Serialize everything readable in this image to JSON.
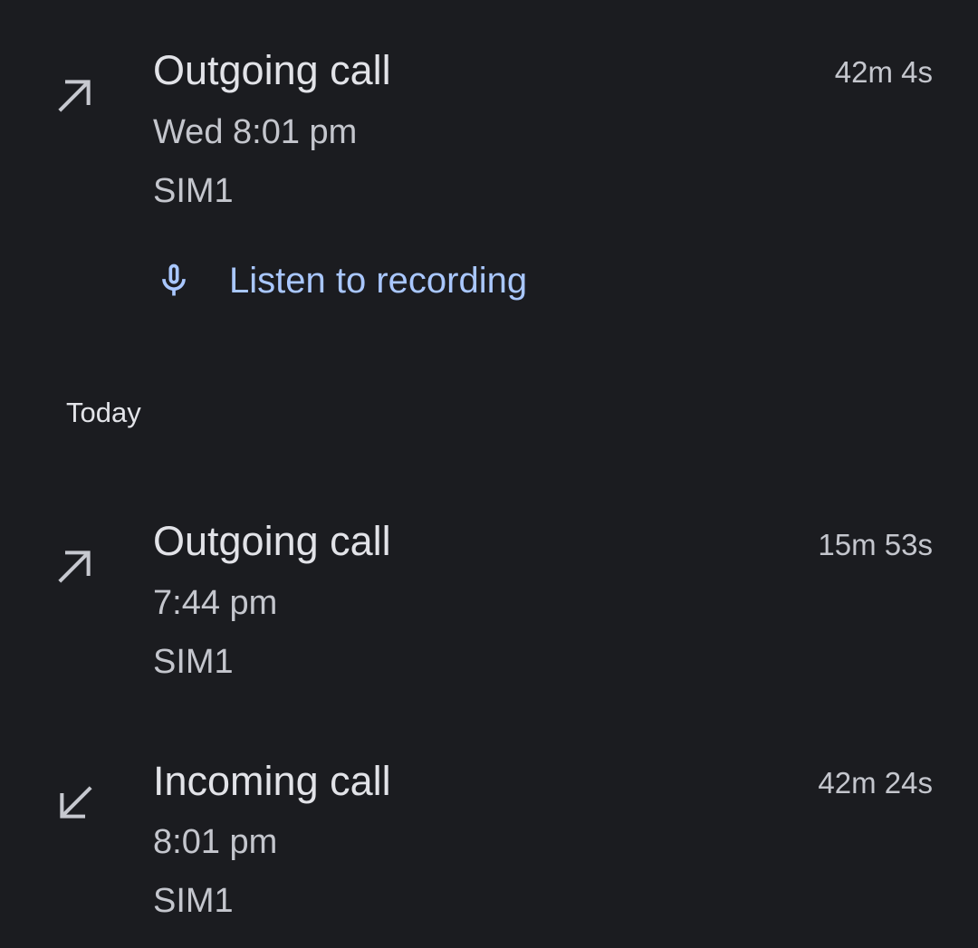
{
  "earlier": {
    "call": {
      "type": "Outgoing call",
      "time": "Wed 8:01 pm",
      "sim": "SIM1",
      "duration": "42m 4s",
      "direction_icon": "outgoing-call-arrow-icon"
    },
    "listen": {
      "label": "Listen to recording",
      "icon": "microphone-icon"
    }
  },
  "today": {
    "header": "Today",
    "calls": [
      {
        "type": "Outgoing call",
        "time": "7:44 pm",
        "sim": "SIM1",
        "duration": "15m 53s",
        "direction_icon": "outgoing-call-arrow-icon"
      },
      {
        "type": "Incoming call",
        "time": "8:01 pm",
        "sim": "SIM1",
        "duration": "42m 24s",
        "direction_icon": "incoming-call-arrow-icon"
      }
    ]
  },
  "colors": {
    "background": "#1b1c20",
    "primary_text": "#e2e3e8",
    "secondary_text": "#c4c6cd",
    "accent": "#a9c7ff"
  }
}
